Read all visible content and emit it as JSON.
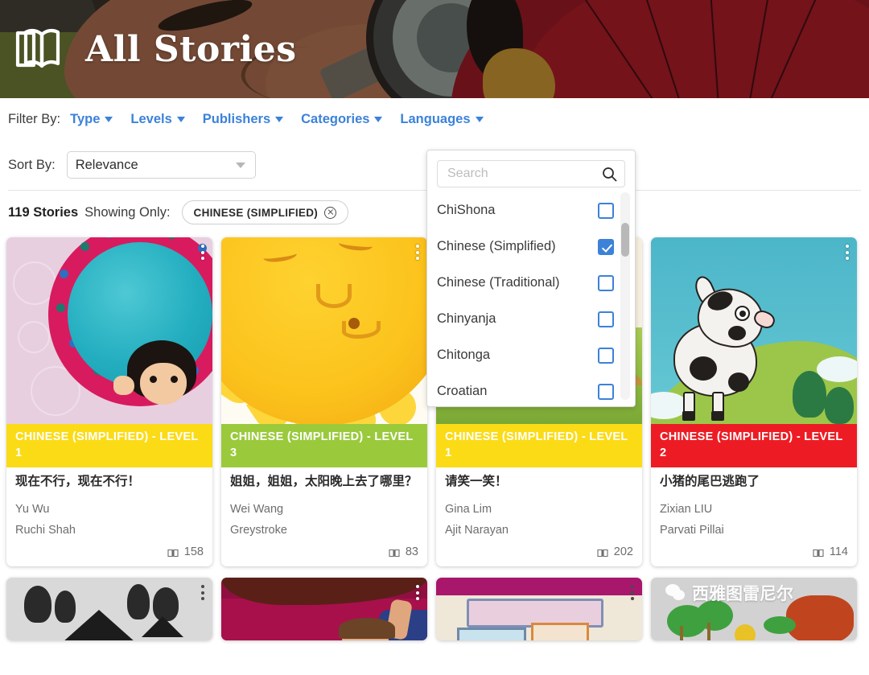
{
  "header": {
    "title": "All Stories",
    "book_icon": "open-book-icon"
  },
  "filters": {
    "label": "Filter By:",
    "items": [
      {
        "label": "Type"
      },
      {
        "label": "Levels"
      },
      {
        "label": "Publishers"
      },
      {
        "label": "Categories"
      },
      {
        "label": "Languages"
      }
    ]
  },
  "sort": {
    "label": "Sort By:",
    "value": "Relevance"
  },
  "results": {
    "count": "119 Stories",
    "showing_label": "Showing Only:",
    "chip": "CHINESE (SIMPLIFIED)"
  },
  "languages_dropdown": {
    "search_placeholder": "Search",
    "search_value": "",
    "search_icon": "magnifier-icon",
    "options": [
      {
        "label": "ChiShona",
        "checked": false
      },
      {
        "label": "Chinese (Simplified)",
        "checked": true
      },
      {
        "label": "Chinese (Traditional)",
        "checked": false
      },
      {
        "label": "Chinyanja",
        "checked": false
      },
      {
        "label": "Chitonga",
        "checked": false
      },
      {
        "label": "Croatian",
        "checked": false
      }
    ]
  },
  "colors": {
    "accent_blue": "#3c82d8",
    "level1_yellow": "#fbdb15",
    "level2_red": "#ed1c24",
    "level3_green": "#9aca3c"
  },
  "cards": [
    {
      "badge": "CHINESE (SIMPLIFIED) - LEVEL 1",
      "badge_color": "#fbdb15",
      "title": "现在不行，现在不行！",
      "author": "Yu Wu",
      "illustrator": "Ruchi Shah",
      "reads": "158",
      "reads_icon": "book-open-icon",
      "menu_icon": "kebab-menu-icon"
    },
    {
      "badge": "CHINESE (SIMPLIFIED) - LEVEL 3",
      "badge_color": "#9aca3c",
      "title": "姐姐，姐姐，太阳晚上去了哪里？",
      "author": "Wei Wang",
      "illustrator": "Greystroke",
      "reads": "83",
      "reads_icon": "book-open-icon",
      "menu_icon": "kebab-menu-icon"
    },
    {
      "badge": "CHINESE (SIMPLIFIED) - LEVEL 1",
      "badge_color": "#fbdb15",
      "title": "请笑一笑！",
      "author": "Gina Lim",
      "illustrator": "Ajit Narayan",
      "reads": "202",
      "reads_icon": "book-open-icon",
      "menu_icon": "kebab-menu-icon"
    },
    {
      "badge": "CHINESE (SIMPLIFIED) - LEVEL 2",
      "badge_color": "#ed1c24",
      "title": "小猪的尾巴逃跑了",
      "author": "Zixian LIU",
      "illustrator": "Parvati Pillai",
      "reads": "114",
      "reads_icon": "book-open-icon",
      "menu_icon": "kebab-menu-icon"
    }
  ],
  "second_row": {
    "watermark": "西雅图雷尼尔",
    "watermark_icon": "wechat-icon"
  }
}
